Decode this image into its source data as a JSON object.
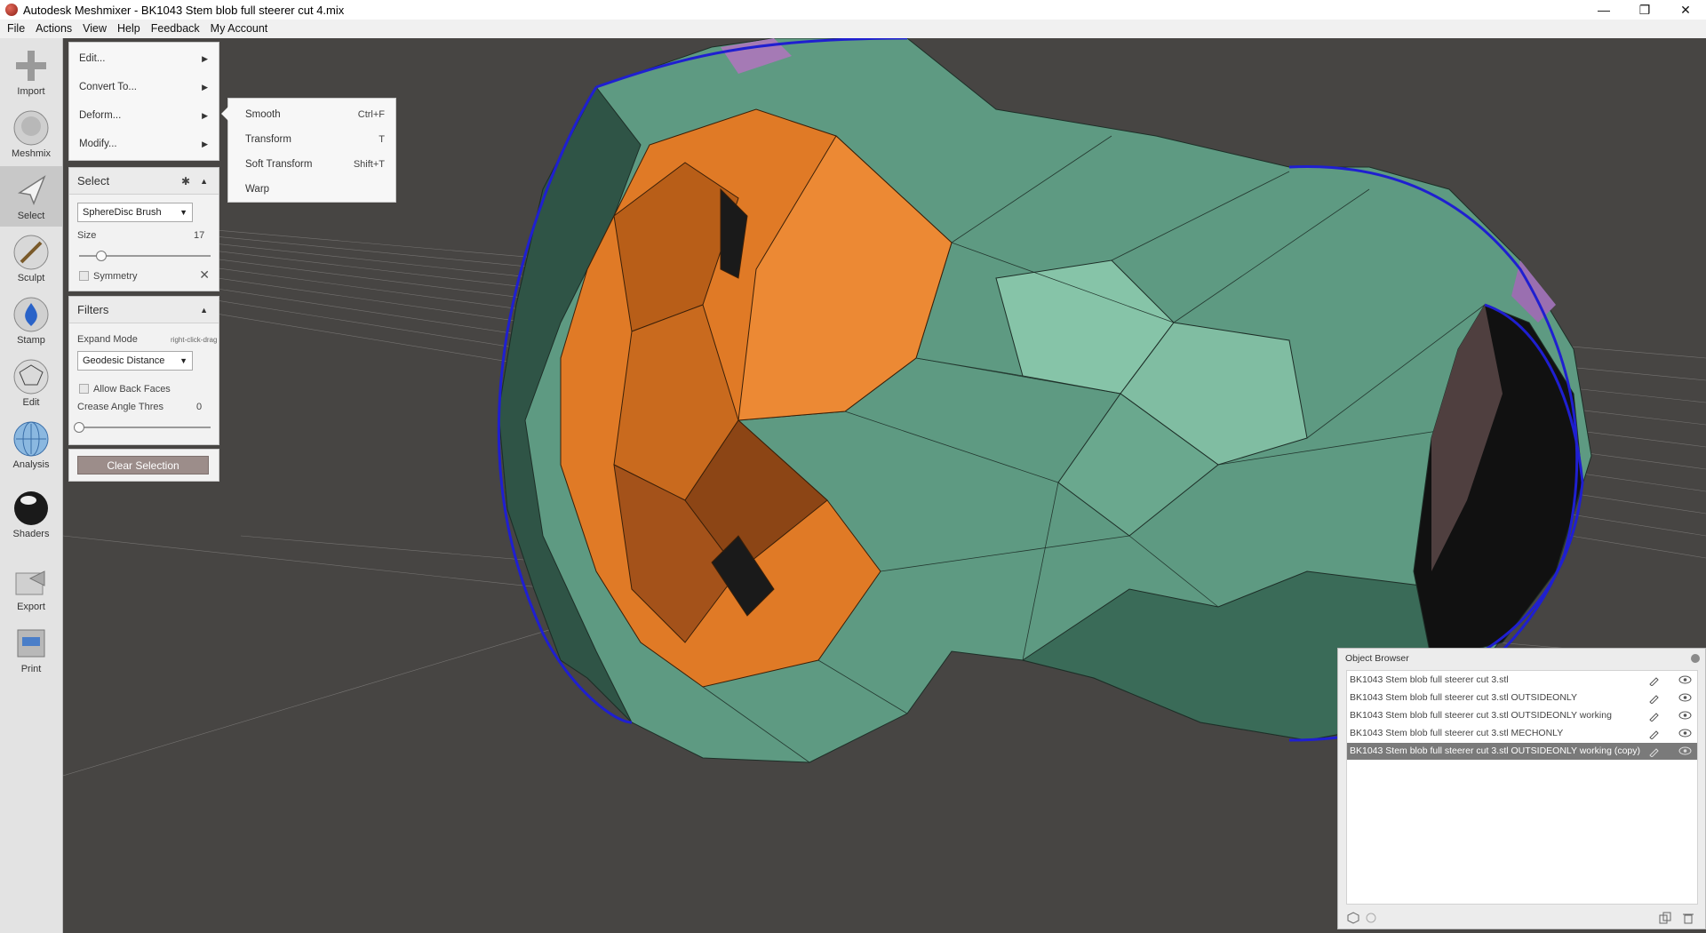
{
  "window": {
    "title": "Autodesk Meshmixer - BK1043 Stem blob full steerer cut 4.mix",
    "minimize_glyph": "—",
    "restore_glyph": "❐",
    "close_glyph": "✕"
  },
  "menubar": {
    "items": [
      "File",
      "Actions",
      "View",
      "Help",
      "Feedback",
      "My Account"
    ]
  },
  "toolbar": {
    "tools": [
      {
        "label": "Import",
        "icon": "plus-icon"
      },
      {
        "label": "Meshmix",
        "icon": "bust-icon"
      },
      {
        "label": "Select",
        "icon": "cursor-arrow-icon"
      },
      {
        "label": "Sculpt",
        "icon": "brush-icon"
      },
      {
        "label": "Stamp",
        "icon": "stamp-icon"
      },
      {
        "label": "Edit",
        "icon": "edit-sphere-icon"
      },
      {
        "label": "Analysis",
        "icon": "analysis-sphere-icon"
      },
      {
        "label": "Shaders",
        "icon": "shader-sphere-icon"
      },
      {
        "label": "Export",
        "icon": "export-icon"
      },
      {
        "label": "Print",
        "icon": "printer-icon"
      }
    ],
    "active": "Select"
  },
  "actions_menu": {
    "items": [
      "Edit...",
      "Convert To...",
      "Deform...",
      "Modify..."
    ]
  },
  "deform_submenu": {
    "items": [
      {
        "label": "Smooth",
        "shortcut": "Ctrl+F"
      },
      {
        "label": "Transform",
        "shortcut": "T"
      },
      {
        "label": "Soft Transform",
        "shortcut": "Shift+T"
      },
      {
        "label": "Warp",
        "shortcut": ""
      }
    ]
  },
  "select_panel": {
    "title": "Select",
    "brush_value": "SphereDisc Brush",
    "size_label": "Size",
    "size_value": "17",
    "size_fraction": 0.17,
    "symmetry_label": "Symmetry"
  },
  "filters_panel": {
    "title": "Filters",
    "expand_mode_label": "Expand Mode",
    "expand_mode_hint": "right-click-drag",
    "expand_mode_value": "Geodesic Distance",
    "allow_back_faces_label": "Allow Back Faces",
    "crease_label": "Crease Angle Thres",
    "crease_value": "0",
    "crease_fraction": 0.0
  },
  "clear_selection_label": "Clear Selection",
  "object_browser": {
    "title": "Object Browser",
    "objects": [
      "BK1043 Stem blob full steerer cut 3.stl",
      "BK1043 Stem blob full steerer cut 3.stl OUTSIDEONLY",
      "BK1043 Stem blob full steerer cut 3.stl OUTSIDEONLY working",
      "BK1043 Stem blob full steerer cut 3.stl MECHONLY",
      "BK1043 Stem blob full steerer cut 3.stl OUTSIDEONLY working (copy)"
    ],
    "selected_index": 4
  },
  "colors": {
    "viewport_bg": "#474543",
    "mesh_green": "#5e9a82",
    "mesh_selected_orange": "#e07a26",
    "boundary_blue": "#1f1fd0",
    "button_clear": "#9c8d8a"
  }
}
